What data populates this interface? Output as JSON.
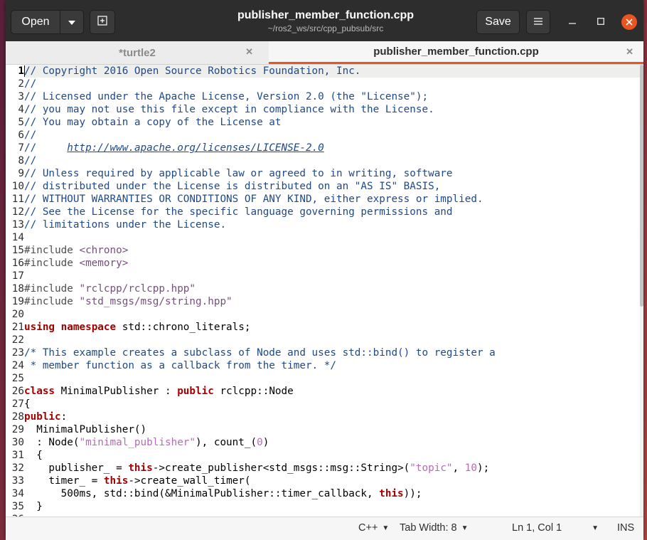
{
  "window": {
    "title": "publisher_member_function.cpp",
    "subtitle": "~/ros2_ws/src/cpp_pubsub/src",
    "open_label": "Open",
    "save_label": "Save"
  },
  "tabs": [
    {
      "label": "*turtle2",
      "active": false
    },
    {
      "label": "publisher_member_function.cpp",
      "active": true
    }
  ],
  "editor": {
    "current_line": 1,
    "lines": [
      [
        {
          "t": "// Copyright 2016 Open Source Robotics Foundation, Inc.",
          "c": "comment"
        }
      ],
      [
        {
          "t": "//",
          "c": "comment"
        }
      ],
      [
        {
          "t": "// Licensed under the Apache License, Version 2.0 (the \"License\");",
          "c": "comment"
        }
      ],
      [
        {
          "t": "// you may not use this file except in compliance with the License.",
          "c": "comment"
        }
      ],
      [
        {
          "t": "// You may obtain a copy of the License at",
          "c": "comment"
        }
      ],
      [
        {
          "t": "//",
          "c": "comment"
        }
      ],
      [
        {
          "t": "//     ",
          "c": "comment"
        },
        {
          "t": "http://www.apache.org/licenses/LICENSE-2.0",
          "c": "link"
        }
      ],
      [
        {
          "t": "//",
          "c": "comment"
        }
      ],
      [
        {
          "t": "// Unless required by applicable law or agreed to in writing, software",
          "c": "comment"
        }
      ],
      [
        {
          "t": "// distributed under the License is distributed on an \"AS IS\" BASIS,",
          "c": "comment"
        }
      ],
      [
        {
          "t": "// WITHOUT WARRANTIES OR CONDITIONS OF ANY KIND, either express or implied.",
          "c": "comment"
        }
      ],
      [
        {
          "t": "// See the License for the specific language governing permissions and",
          "c": "comment"
        }
      ],
      [
        {
          "t": "// limitations under the License.",
          "c": "comment"
        }
      ],
      [],
      [
        {
          "t": "#include ",
          "c": "pre"
        },
        {
          "t": "<chrono>",
          "c": "inc"
        }
      ],
      [
        {
          "t": "#include ",
          "c": "pre"
        },
        {
          "t": "<memory>",
          "c": "inc"
        }
      ],
      [],
      [
        {
          "t": "#include ",
          "c": "pre"
        },
        {
          "t": "\"rclcpp/rclcpp.hpp\"",
          "c": "inc"
        }
      ],
      [
        {
          "t": "#include ",
          "c": "pre"
        },
        {
          "t": "\"std_msgs/msg/string.hpp\"",
          "c": "inc"
        }
      ],
      [],
      [
        {
          "t": "using",
          "c": "kw"
        },
        {
          "t": " "
        },
        {
          "t": "namespace",
          "c": "kw"
        },
        {
          "t": " std::chrono_literals;"
        }
      ],
      [],
      [
        {
          "t": "/* This example creates a subclass of Node and uses std::bind() to register a",
          "c": "comment"
        }
      ],
      [
        {
          "t": " * member function as a callback from the timer. */",
          "c": "comment"
        }
      ],
      [],
      [
        {
          "t": "class",
          "c": "kw"
        },
        {
          "t": " MinimalPublisher : "
        },
        {
          "t": "public",
          "c": "kw"
        },
        {
          "t": " rclcpp::Node"
        }
      ],
      [
        {
          "t": "{"
        }
      ],
      [
        {
          "t": "public",
          "c": "kw"
        },
        {
          "t": ":"
        }
      ],
      [
        {
          "t": "  MinimalPublisher()"
        }
      ],
      [
        {
          "t": "  : Node("
        },
        {
          "t": "\"minimal_publisher\"",
          "c": "str"
        },
        {
          "t": "), count_("
        },
        {
          "t": "0",
          "c": "num"
        },
        {
          "t": ")"
        }
      ],
      [
        {
          "t": "  {"
        }
      ],
      [
        {
          "t": "    publisher_ = "
        },
        {
          "t": "this",
          "c": "kw"
        },
        {
          "t": "->create_publisher<std_msgs::msg::String>("
        },
        {
          "t": "\"topic\"",
          "c": "str"
        },
        {
          "t": ", "
        },
        {
          "t": "10",
          "c": "num"
        },
        {
          "t": ");"
        }
      ],
      [
        {
          "t": "    timer_ = "
        },
        {
          "t": "this",
          "c": "kw"
        },
        {
          "t": "->create_wall_timer("
        }
      ],
      [
        {
          "t": "      500ms, std::bind(&MinimalPublisher::timer_callback, "
        },
        {
          "t": "this",
          "c": "kw"
        },
        {
          "t": "));"
        }
      ],
      [
        {
          "t": "  }"
        }
      ],
      [
        {
          "t": ""
        }
      ]
    ]
  },
  "statusbar": {
    "language": "C++",
    "tab_width": "Tab Width: 8",
    "position": "Ln 1, Col 1",
    "mode": "INS"
  },
  "colors": {
    "accent": "#e95420",
    "comment": "#204a87",
    "keyword": "#a40000",
    "string": "#b36db5"
  }
}
